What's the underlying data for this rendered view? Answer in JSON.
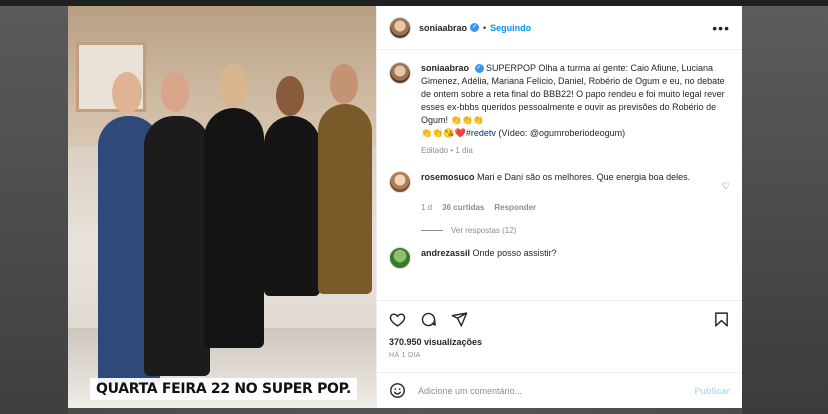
{
  "post": {
    "author": "soniaabrao",
    "follow_label": "Seguindo",
    "separator": "•",
    "more_label": "•••",
    "caption": {
      "author": "soniaabrao",
      "text": "SUPERPOP Olha a turma aí gente: Caio Afiune, Luciana Gimenez, Adélia, Mariana Felício, Daniel, Robério de Ogum e eu, no debate de ontem sobre a reta final do BBB22! O papo rendeu e foi muito legal rever esses ex-bbbs queridos pessoalmente e ouvir as previsões do Robério de Ogum! 👏👏👏",
      "line2": "👏👏😘❤️",
      "hashtag": "#redetv",
      "video_credit": "(Vídeo: @ogumroberiodeogum)"
    },
    "edited_label": "Editado",
    "edited_sep": "•",
    "edited_time": "1 dia",
    "media_caption": "QUARTA FEIRA 22 NO SUPER POP."
  },
  "comments": [
    {
      "user": "rosemosuco",
      "text": "Mari e Dani são os melhores. Que energia boa deles.",
      "time": "1 d",
      "likes": "36 curtidas",
      "reply_label": "Responder",
      "view_replies": "Ver respostas (12)"
    },
    {
      "user": "andrezassil",
      "text": "Onde posso assistir?"
    }
  ],
  "stats": {
    "views": "370.950 visualizações",
    "ago": "HÁ 1 DIA"
  },
  "composer": {
    "placeholder": "Adicione um comentário...",
    "publish_label": "Publicar"
  }
}
